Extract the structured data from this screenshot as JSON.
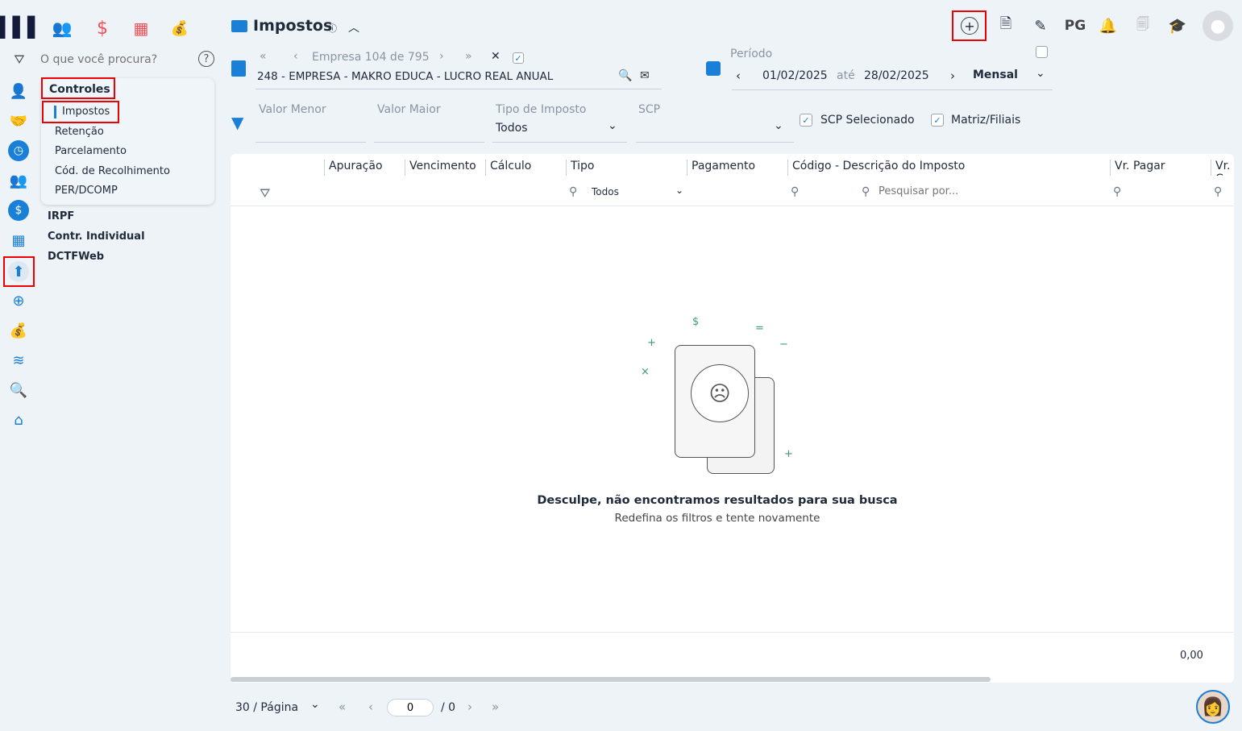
{
  "topnav": {
    "search_placeholder": "O que você procura?"
  },
  "menu": {
    "group": "Controles",
    "items": [
      "Impostos",
      "Retenção",
      "Parcelamento",
      "Cód. de Recolhimento",
      "PER/DCOMP"
    ],
    "other": [
      "IRPF",
      "Contr. Individual",
      "DCTFWeb"
    ]
  },
  "header": {
    "title": "Impostos",
    "pg": "PG"
  },
  "company": {
    "nav": "Empresa 104 de 795",
    "name": "248 - EMPRESA - MAKRO EDUCA - LUCRO REAL ANUAL"
  },
  "period": {
    "label": "Período",
    "from": "01/02/2025",
    "sep": "até",
    "to": "28/02/2025",
    "mode": "Mensal"
  },
  "filters": {
    "valor_menor": "Valor Menor",
    "valor_maior": "Valor Maior",
    "tipo_label": "Tipo de Imposto",
    "tipo_value": "Todos",
    "scp": "SCP",
    "scp_sel": "SCP Selecionado",
    "matriz": "Matriz/Filiais"
  },
  "table": {
    "columns": [
      "Apuração",
      "Vencimento",
      "Cálculo",
      "Tipo",
      "Pagamento",
      "Código - Descrição do Imposto",
      "Vr. Pagar",
      "Vr. C"
    ],
    "tipo_filter": "Todos",
    "search_placeholder": "Pesquisar por...",
    "total": "0,00"
  },
  "empty": {
    "title": "Desculpe, não encontramos resultados para sua busca",
    "subtitle": "Redefina os filtros e tente novamente"
  },
  "pager": {
    "per_page": "30 / Página",
    "page": "0",
    "total": "/ 0"
  }
}
